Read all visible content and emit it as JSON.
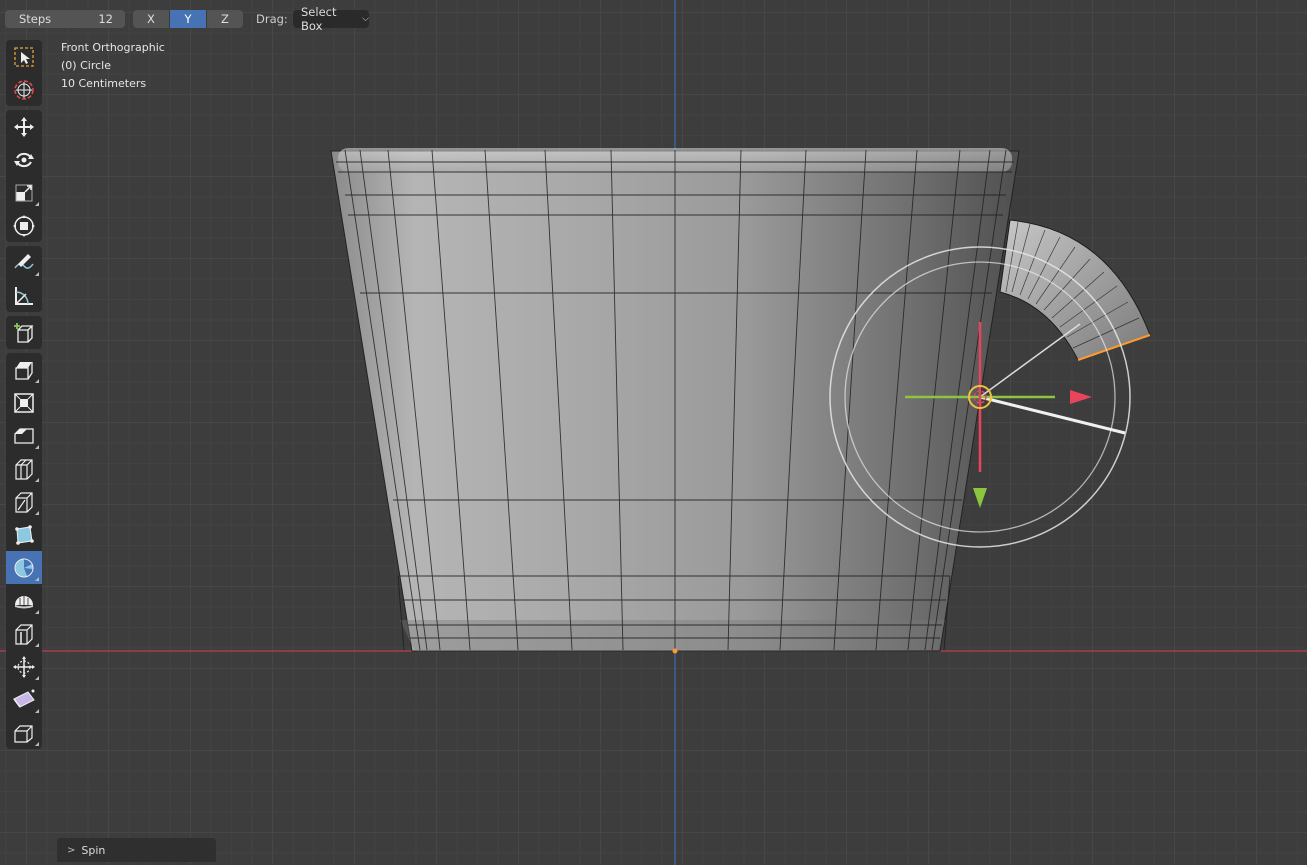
{
  "header": {
    "steps_label": "Steps",
    "steps_value": "12",
    "axes": [
      {
        "label": "X",
        "active": false
      },
      {
        "label": "Y",
        "active": true
      },
      {
        "label": "Z",
        "active": false
      }
    ],
    "drag_label": "Drag:",
    "drag_value": "Select Box"
  },
  "overlay": {
    "view_name": "Front Orthographic",
    "object_name": "(0) Circle",
    "scale": "10 Centimeters"
  },
  "toolbar": {
    "tools": [
      {
        "name": "select-box-icon",
        "active": false
      },
      {
        "name": "cursor-icon",
        "active": false
      },
      {
        "name": "move-icon",
        "active": false
      },
      {
        "name": "rotate-icon",
        "active": false
      },
      {
        "name": "scale-icon",
        "active": false
      },
      {
        "name": "transform-icon",
        "active": false
      },
      {
        "name": "annotate-icon",
        "active": false
      },
      {
        "name": "measure-icon",
        "active": false
      },
      {
        "name": "add-cube-icon",
        "active": false
      },
      {
        "name": "extrude-icon",
        "active": false
      },
      {
        "name": "inset-icon",
        "active": false
      },
      {
        "name": "bevel-icon",
        "active": false
      },
      {
        "name": "loop-cut-icon",
        "active": false
      },
      {
        "name": "knife-icon",
        "active": false
      },
      {
        "name": "poly-build-icon",
        "active": false
      },
      {
        "name": "spin-icon",
        "active": true
      },
      {
        "name": "smooth-icon",
        "active": false
      },
      {
        "name": "edge-slide-icon",
        "active": false
      },
      {
        "name": "shrink-fatten-icon",
        "active": false
      },
      {
        "name": "shear-icon",
        "active": false
      },
      {
        "name": "rip-region-icon",
        "active": false
      }
    ]
  },
  "operator_panel": {
    "label": "Spin"
  },
  "colors": {
    "accent": "#4772b3",
    "x_axis": "#e8455c",
    "y_axis": "#8cc63f",
    "z_axis": "#4a7ec7",
    "selection": "#ff9a2e"
  }
}
